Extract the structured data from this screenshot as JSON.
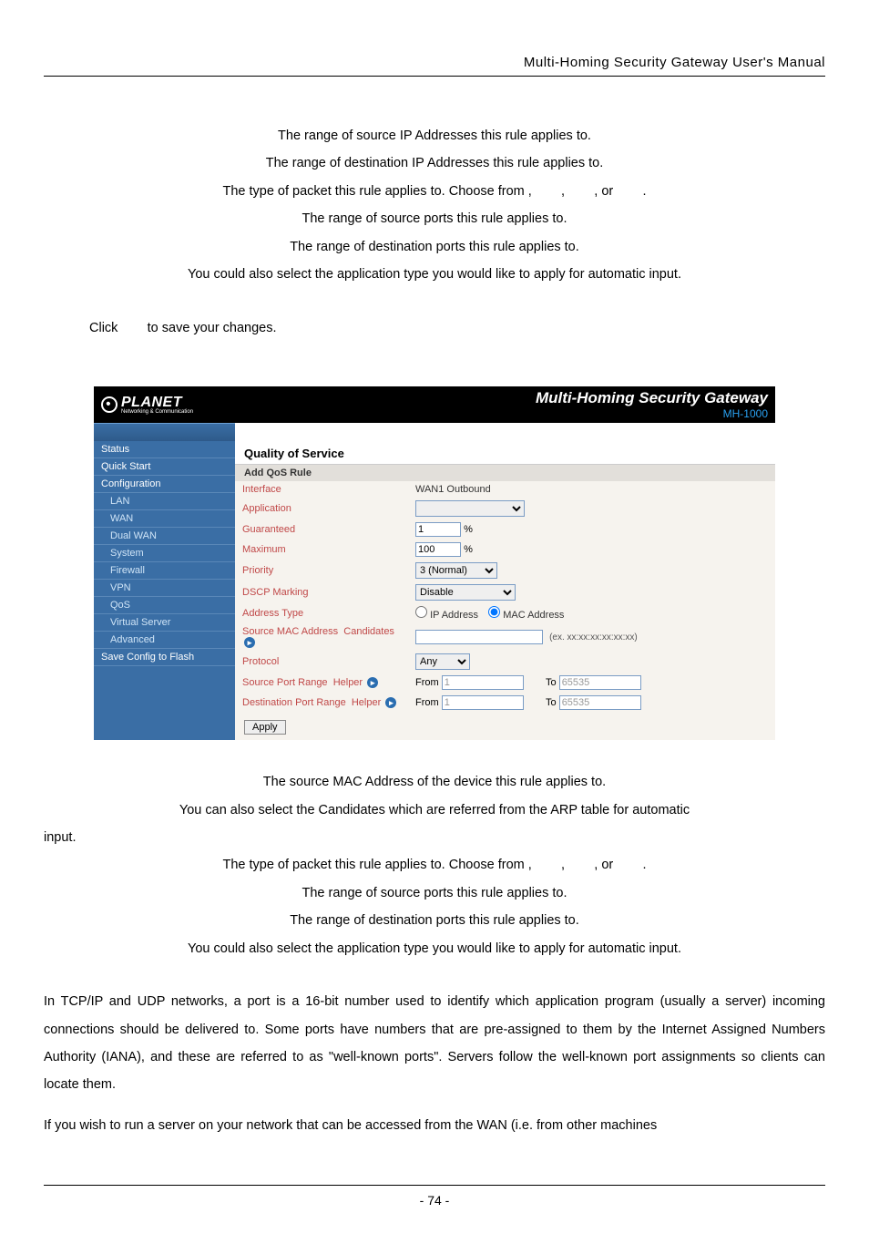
{
  "header": {
    "right_text": "Multi-Homing Security Gateway User's Manual"
  },
  "top_text": {
    "line1": "The range of source IP Addresses this rule applies to.",
    "line2": "The range of destination IP Addresses this rule applies to.",
    "line3_pre": "The type of packet this rule applies to. Choose from",
    "line3_sep": ",        ,        , or        .",
    "line4": "The range of source ports this rule applies to.",
    "line5": "The range of destination ports this rule applies to.",
    "line6": "You could also select the application type you would like to apply for automatic input.",
    "line7_pre": "Click",
    "line7_post": "to save your changes."
  },
  "ui": {
    "brand": {
      "name": "PLANET",
      "sub": "Networking & Communication"
    },
    "hero": {
      "title": "Multi-Homing Security Gateway",
      "model": "MH-1000"
    },
    "sidebar": [
      {
        "label": "Status",
        "sub": false
      },
      {
        "label": "Quick Start",
        "sub": false
      },
      {
        "label": "Configuration",
        "sub": false
      },
      {
        "label": "LAN",
        "sub": true
      },
      {
        "label": "WAN",
        "sub": true
      },
      {
        "label": "Dual WAN",
        "sub": true
      },
      {
        "label": "System",
        "sub": true
      },
      {
        "label": "Firewall",
        "sub": true
      },
      {
        "label": "VPN",
        "sub": true
      },
      {
        "label": "QoS",
        "sub": true
      },
      {
        "label": "Virtual Server",
        "sub": true
      },
      {
        "label": "Advanced",
        "sub": true
      },
      {
        "label": "Save Config to Flash",
        "sub": false
      }
    ],
    "section_title": "Quality of Service",
    "subhead": "Add QoS Rule",
    "form": {
      "interface_label": "Interface",
      "interface_value": "WAN1 Outbound",
      "application_label": "Application",
      "guaranteed_label": "Guaranteed",
      "guaranteed_value": "1",
      "percent": "%",
      "maximum_label": "Maximum",
      "maximum_value": "100",
      "priority_label": "Priority",
      "priority_value": "3 (Normal)",
      "dscp_label": "DSCP Marking",
      "dscp_value": "Disable",
      "addrtype_label": "Address Type",
      "addrtype_ip": "IP Address",
      "addrtype_mac": "MAC Address",
      "srcmac_label": "Source MAC Address",
      "candidates": "Candidates",
      "srcmac_hint": "(ex. xx:xx:xx:xx:xx:xx)",
      "protocol_label": "Protocol",
      "protocol_value": "Any",
      "srcport_label": "Source Port Range",
      "dstport_label": "Destination Port Range",
      "helper": "Helper",
      "from": "From",
      "to": "To",
      "port_from": "1",
      "port_to": "65535",
      "apply": "Apply"
    }
  },
  "bottom_text": {
    "line1": "The source MAC Address of the device this rule applies to.",
    "line2a": "You can also select the Candidates which are referred from the ARP table for automatic",
    "line2b": "input.",
    "line3_pre": "The type of packet this rule applies to. Choose from",
    "line3_sep": ",        ,        , or        .",
    "line4": "The range of source ports this rule applies to.",
    "line5": "The range of destination ports this rule applies to.",
    "line6": "You could also select the application type you would like to apply for automatic input.",
    "para1": "In TCP/IP and UDP networks, a port is a 16-bit number used to identify which application program (usually a server) incoming connections should be delivered to. Some ports have numbers that are pre-assigned to them by the Internet Assigned Numbers Authority (IANA), and these are referred to as \"well-known ports\". Servers follow the well-known port assignments so clients can locate them.",
    "para2": "If you wish to run a server on your network that can be accessed from the WAN (i.e. from other machines"
  },
  "footer": {
    "page": "- 74 -"
  }
}
